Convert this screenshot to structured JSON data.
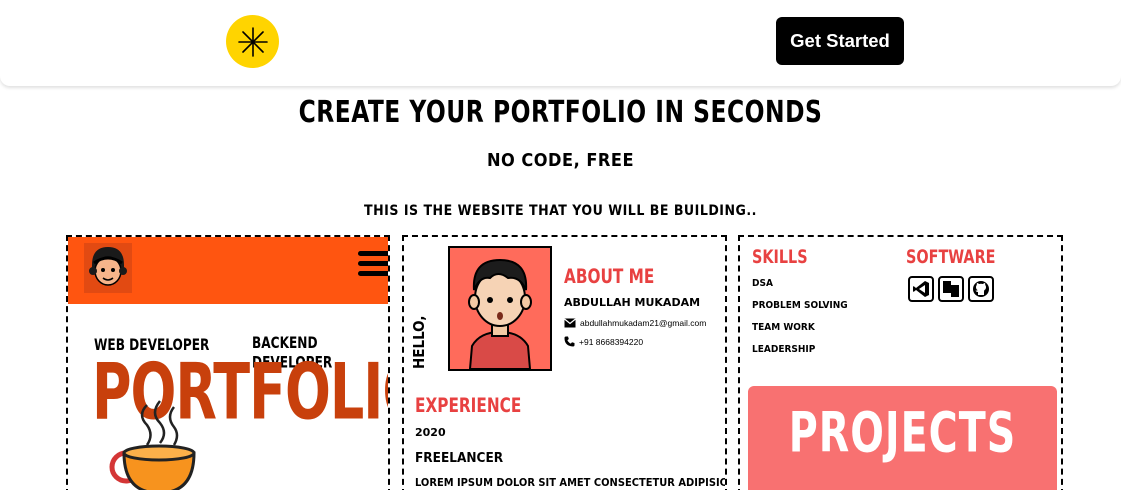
{
  "navbar": {
    "cta_label": "Get Started"
  },
  "hero": {
    "title": "CREATE YOUR PORTFOLIO IN SECONDS",
    "subtitle": "NO CODE, FREE",
    "caption": "THIS IS THE WEBSITE THAT YOU WILL BE BUILDING.."
  },
  "preview1": {
    "role_left": "WEB DEVELOPER",
    "role_right": "BACKEND DEVELOPER",
    "big_title": "PORTFOLIO"
  },
  "preview2": {
    "hello": "HELLO,",
    "about_title": "ABOUT ME",
    "name": "ABDULLAH MUKADAM",
    "email": "abdullahmukadam21@gmail.com",
    "phone": "+91 8668394220",
    "experience_title": "EXPERIENCE",
    "year": "2020",
    "role": "FREELANCER",
    "description": "LOREM IPSUM DOLOR SIT AMET CONSECTETUR ADIPISICING ELIT."
  },
  "preview3": {
    "skills_title": "SKILLS",
    "skills": [
      "DSA",
      "PROBLEM SOLVING",
      "TEAM WORK",
      "LEADERSHIP"
    ],
    "software_title": "SOFTWARE",
    "software_icons": [
      "vscode-icon",
      "figma-icon",
      "github-icon"
    ],
    "projects_label": "PROJECTS"
  },
  "colors": {
    "logo_yellow": "#ffd400",
    "cta_black": "#000000",
    "orange_header": "#ff5510",
    "portfolio_text": "#c8400c",
    "accent_red": "#e84141",
    "projects_bg": "#f87171"
  }
}
